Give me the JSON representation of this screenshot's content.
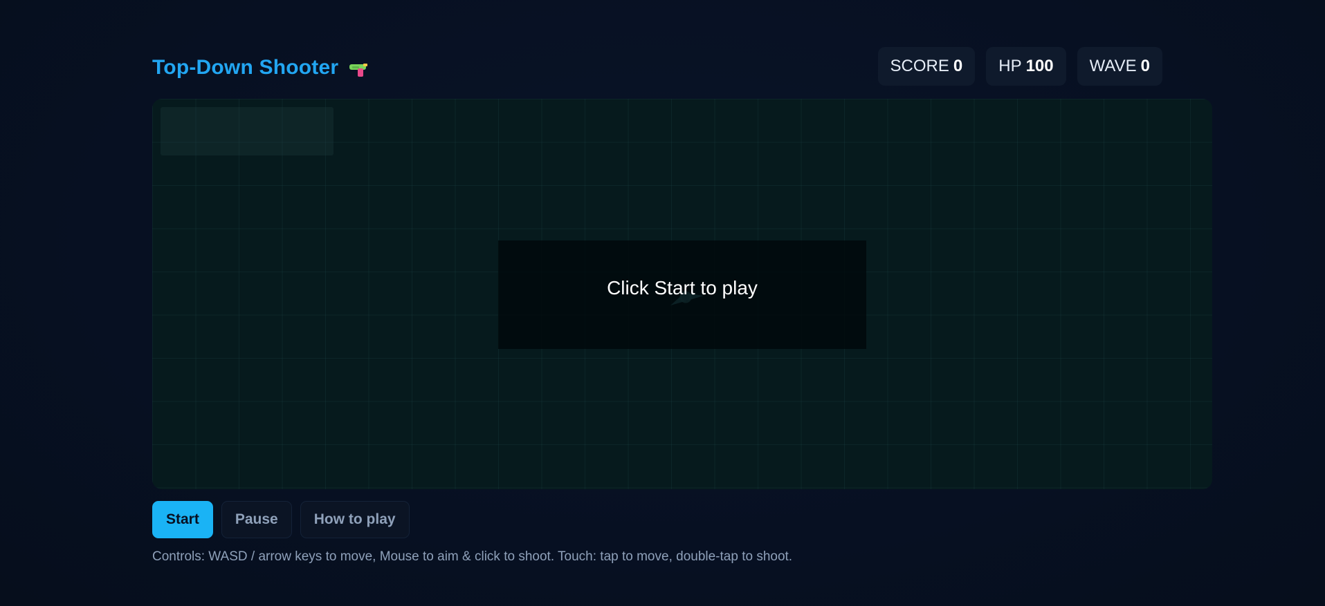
{
  "header": {
    "title": "Top-Down Shooter",
    "title_icon": "water-gun-icon"
  },
  "stats": [
    {
      "label": "SCORE",
      "value": "0"
    },
    {
      "label": "HP",
      "value": "100"
    },
    {
      "label": "WAVE",
      "value": "0"
    }
  ],
  "arena": {
    "overlay_text": "Click Start to play",
    "player_icon": "arrow-ship-icon"
  },
  "controls": {
    "start_label": "Start",
    "pause_label": "Pause",
    "howto_label": "How to play"
  },
  "help_text": "Controls: WASD / arrow keys to move, Mouse to aim & click to shoot. Touch: tap to move, double-tap to shoot.",
  "colors": {
    "accent": "#1ab3f5",
    "title": "#22a6f2",
    "background": "#071022",
    "arena": "#061a1d"
  }
}
